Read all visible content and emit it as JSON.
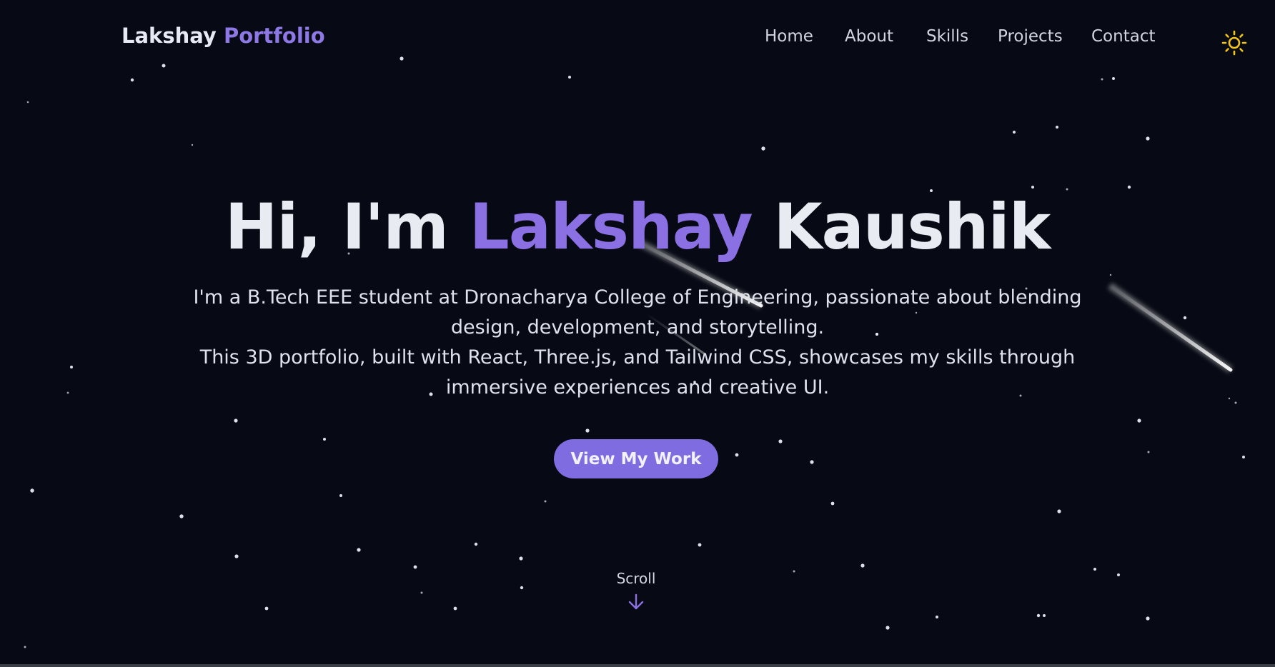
{
  "navbar": {
    "logo_first": "Lakshay",
    "logo_second": "Portfolio",
    "links": [
      "Home",
      "About",
      "Skills",
      "Projects",
      "Contact"
    ],
    "theme_icon": "sun-icon"
  },
  "hero": {
    "greeting": "Hi, I'm",
    "name_first": "Lakshay",
    "name_last": "Kaushik",
    "description_1": "I'm a B.Tech EEE student at Dronacharya College of Engineering, passionate about blending design, development, and storytelling.",
    "description_2": "This 3D portfolio, built with React, Three.js, and Tailwind CSS, showcases my skills through immersive experiences and creative UI.",
    "cta_label": "View My Work"
  },
  "scroll": {
    "label": "Scroll",
    "icon": "arrow-down-icon"
  },
  "colors": {
    "background": "#070a14",
    "accent": "#8a70e2",
    "button": "#7f6ce0",
    "sun": "#f2c517",
    "text": "#e9ebf3"
  }
}
